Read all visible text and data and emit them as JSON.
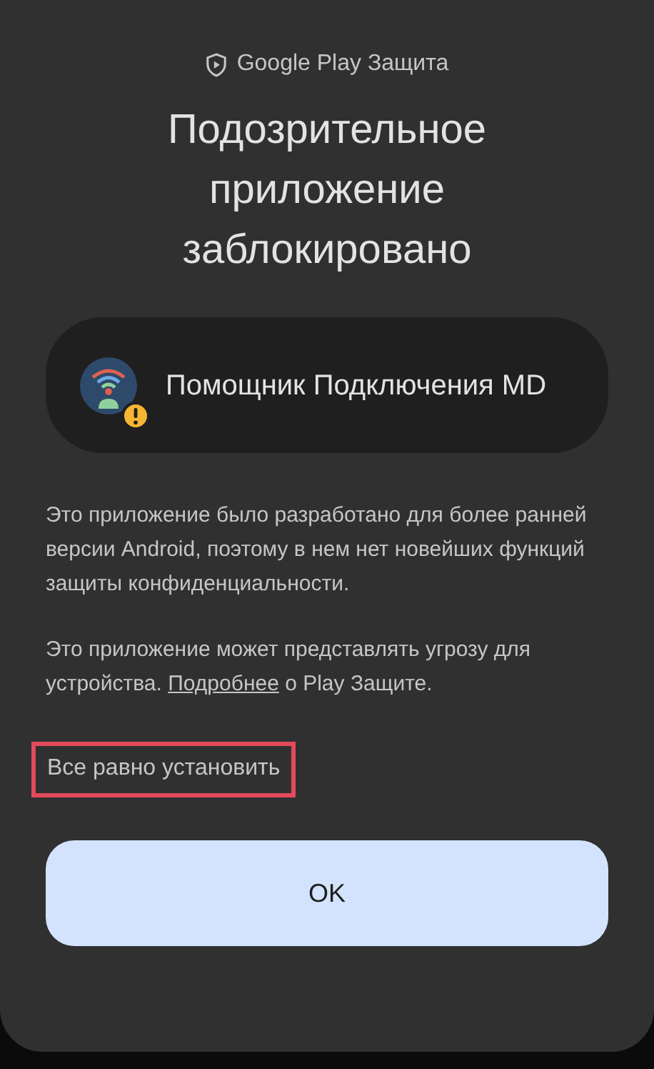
{
  "header": {
    "brand": "Google Play Защита"
  },
  "title": "Подозрительное приложение заблокировано",
  "app": {
    "name": "Помощник Подключения MD",
    "warning": true
  },
  "paragraphs": [
    {
      "text": "Это приложение было разработано для более ранней версии Android, поэтому в нем нет новейших функций защиты конфиденциальности."
    },
    {
      "text": "Это приложение может представлять угрозу для устройства.",
      "link": "Подробнее",
      "after": "о Play Защите."
    }
  ],
  "install_anyway": {
    "label": "Все равно установить",
    "highlighted": true
  },
  "buttons": [
    {
      "label": "OK"
    }
  ]
}
